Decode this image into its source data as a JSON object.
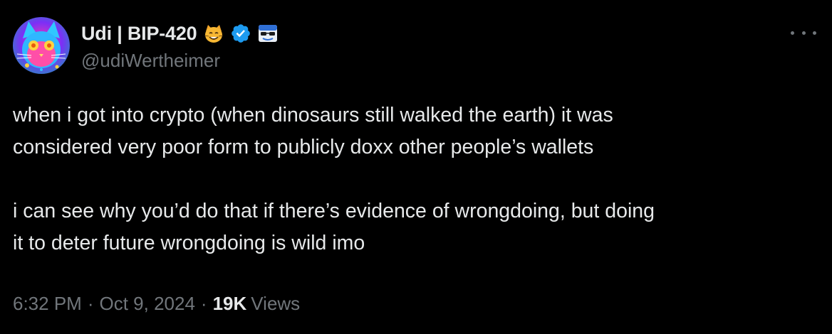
{
  "author": {
    "display_name": "Udi | BIP-420",
    "handle": "@udiWertheimer",
    "badges": [
      "cat-face-icon",
      "verified-badge-icon",
      "sunglasses-flag-icon"
    ],
    "verified_color": "#1d9bf0"
  },
  "tweet": {
    "paragraphs": [
      {
        "line1": "when i got into crypto (when dinosaurs still walked the earth) it was",
        "line2": "considered very poor form to publicly doxx other people’s wallets"
      },
      {
        "line1": "i can see why you’d do that if there’s evidence of wrongdoing, but doing",
        "line2": "it to deter future wrongdoing is wild imo"
      }
    ],
    "time": "6:32 PM",
    "date": "Oct 9, 2024",
    "separator": "·",
    "views_count": "19K",
    "views_label": "Views"
  },
  "colors": {
    "background": "#000000",
    "text_primary": "#e7e9ea",
    "text_secondary": "#71767b"
  }
}
